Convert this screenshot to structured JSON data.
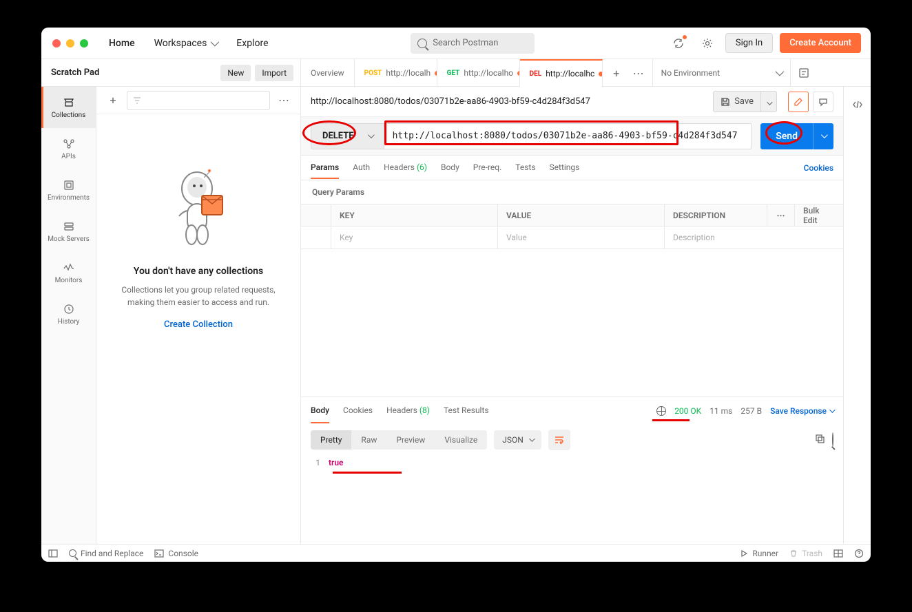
{
  "header": {
    "home": "Home",
    "workspaces": "Workspaces",
    "explore": "Explore",
    "search_placeholder": "Search Postman",
    "sign_in": "Sign In",
    "create_account": "Create Account"
  },
  "scratch": {
    "title": "Scratch Pad",
    "new": "New",
    "import": "Import"
  },
  "rail": {
    "collections": "Collections",
    "apis": "APIs",
    "environments": "Environments",
    "mock_servers": "Mock Servers",
    "monitors": "Monitors",
    "history": "History"
  },
  "empty": {
    "title": "You don't have any collections",
    "text": "Collections let you group related requests, making them easier to access and run.",
    "cta": "Create Collection"
  },
  "tabs": {
    "overview": "Overview",
    "post": "http://localh",
    "get": "http://localho",
    "del": "http://localhc"
  },
  "env": {
    "label": "No Environment"
  },
  "request": {
    "title": "http://localhost:8080/todos/03071b2e-aa86-4903-bf59-c4d284f3d547",
    "save": "Save",
    "method": "DELETE",
    "url": "http://localhost:8080/todos/03071b2e-aa86-4903-bf59-c4d284f3d547",
    "send": "Send"
  },
  "rtabs": {
    "params": "Params",
    "auth": "Auth",
    "headers": "Headers",
    "headers_count": "(6)",
    "body": "Body",
    "prereq": "Pre-req.",
    "tests": "Tests",
    "settings": "Settings",
    "cookies": "Cookies"
  },
  "qp": {
    "label": "Query Params",
    "key_h": "KEY",
    "val_h": "VALUE",
    "desc_h": "DESCRIPTION",
    "bulk": "Bulk Edit",
    "key_ph": "Key",
    "val_ph": "Value",
    "desc_ph": "Description"
  },
  "resp": {
    "body": "Body",
    "cookies": "Cookies",
    "headers": "Headers",
    "headers_count": "(8)",
    "tests": "Test Results",
    "status": "200 OK",
    "time": "11 ms",
    "size": "257 B",
    "save": "Save Response"
  },
  "seg": {
    "pretty": "Pretty",
    "raw": "Raw",
    "preview": "Preview",
    "visualize": "Visualize",
    "format": "JSON"
  },
  "code": {
    "line1": "true"
  },
  "status": {
    "find": "Find and Replace",
    "console": "Console",
    "runner": "Runner",
    "trash": "Trash"
  }
}
